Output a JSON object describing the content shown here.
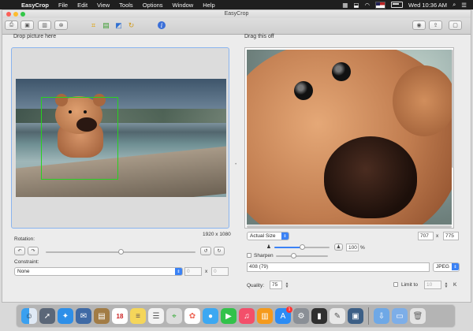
{
  "menubar": {
    "app_name": "EasyCrop",
    "menus": [
      "File",
      "Edit",
      "View",
      "Tools",
      "Options",
      "Window",
      "Help"
    ],
    "clock": "Wed 10:36 AM"
  },
  "window": {
    "title": "EasyCrop"
  },
  "left": {
    "heading": "Drop picture here",
    "image_size": "1920 x 1080",
    "rotation_label": "Rotation:",
    "rotation_level": 0.5,
    "constraint_label": "Constraint:",
    "constraint_value": "None",
    "constraint_w": "0",
    "constraint_x": "x",
    "constraint_h": "0"
  },
  "right": {
    "heading": "Drag this off",
    "zoom_select": "Actual Size",
    "width": "707",
    "x": "x",
    "height": "775",
    "scale_percent": "100",
    "percent_sign": "%",
    "scale_level": 1.0,
    "sharpen_label": "Sharpen",
    "sharpen_level": 0.3,
    "file_size": "408 (79)",
    "format": "JPEG",
    "quality_label": "Quality:",
    "quality_value": "75",
    "limit_label": "Limit to",
    "limit_value": "10",
    "limit_unit": "K"
  },
  "dock": {
    "calendar_day": "18",
    "badge_count": "1"
  }
}
